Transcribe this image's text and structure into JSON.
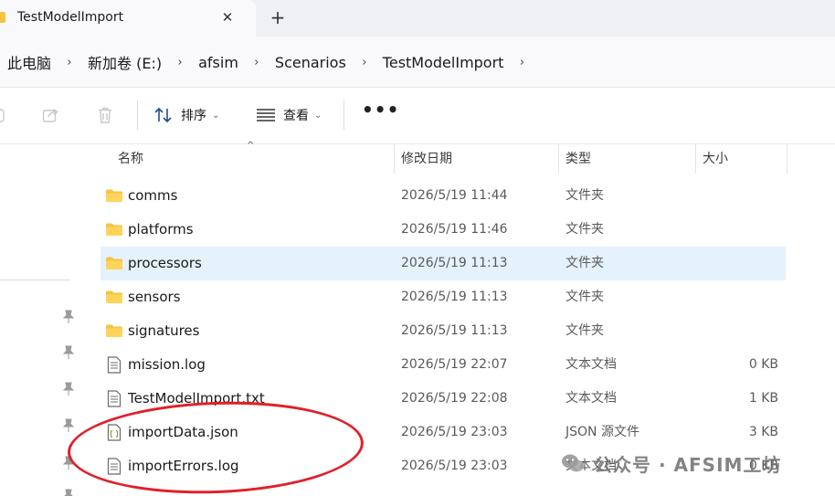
{
  "window": {
    "tab_title": "TestModelImport",
    "tab_close_glyph": "✕",
    "new_tab_glyph": "+"
  },
  "breadcrumb": {
    "items": [
      "此电脑",
      "新加卷 (E:)",
      "afsim",
      "Scenarios",
      "TestModelImport"
    ],
    "separator": "›"
  },
  "toolbar": {
    "sort_label": "排序",
    "view_label": "查看",
    "more_label": "•••",
    "caret": "⌄"
  },
  "columns": {
    "name": "名称",
    "date": "修改日期",
    "type": "类型",
    "size": "大小",
    "sort_indicator": "^"
  },
  "files": [
    {
      "name": "comms",
      "date": "2026/5/19 11:44",
      "type": "文件夹",
      "size": "",
      "icon": "folder-icon"
    },
    {
      "name": "platforms",
      "date": "2026/5/19 11:46",
      "type": "文件夹",
      "size": "",
      "icon": "folder-icon"
    },
    {
      "name": "processors",
      "date": "2026/5/19 11:13",
      "type": "文件夹",
      "size": "",
      "icon": "folder-icon",
      "selected": true
    },
    {
      "name": "sensors",
      "date": "2026/5/19 11:13",
      "type": "文件夹",
      "size": "",
      "icon": "folder-icon"
    },
    {
      "name": "signatures",
      "date": "2026/5/19 11:13",
      "type": "文件夹",
      "size": "",
      "icon": "folder-icon"
    },
    {
      "name": "mission.log",
      "date": "2026/5/19 22:07",
      "type": "文本文档",
      "size": "0 KB",
      "icon": "text-file-icon"
    },
    {
      "name": "TestModelImport.txt",
      "date": "2026/5/19 22:08",
      "type": "文本文档",
      "size": "1 KB",
      "icon": "text-file-icon"
    },
    {
      "name": "importData.json",
      "date": "2026/5/19 23:03",
      "type": "JSON 源文件",
      "size": "3 KB",
      "icon": "json-file-icon"
    },
    {
      "name": "importErrors.log",
      "date": "2026/5/19 23:03",
      "type": "文本文档",
      "size": "0 KB",
      "icon": "text-file-icon"
    }
  ],
  "watermark": {
    "text": "公众号 · AFSIM工坊"
  },
  "colors": {
    "accent_selected": "#e5f1fb",
    "folder": "#f5c542",
    "annotation": "#e0202a"
  }
}
